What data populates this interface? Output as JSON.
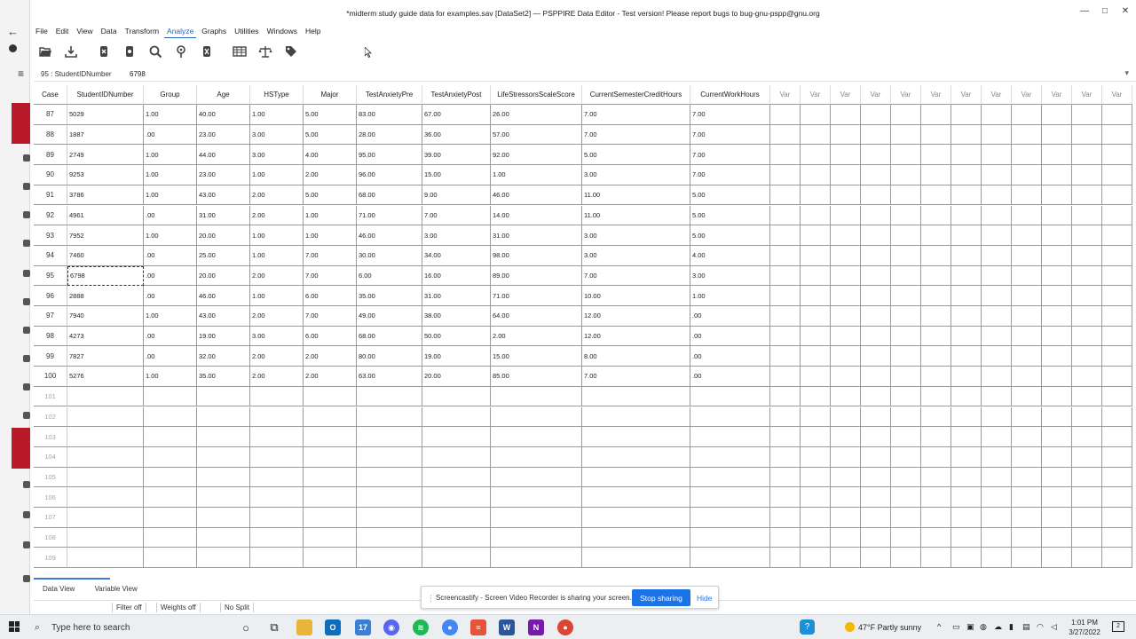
{
  "window": {
    "title": "*midterm study guide data for examples.sav [DataSet2] — PSPPIRE Data Editor - Test version! Please report bugs to bug-gnu-pspp@gnu.org",
    "minimize_glyph": "—",
    "maximize_glyph": "□",
    "close_glyph": "✕"
  },
  "menu": [
    "File",
    "Edit",
    "View",
    "Data",
    "Transform",
    "Analyze",
    "Graphs",
    "Utilities",
    "Windows",
    "Help"
  ],
  "menu_active": "Analyze",
  "toolbar_icons": [
    "open-icon",
    "save-icon",
    "goto-case-icon",
    "goto-variable-icon",
    "find-icon",
    "insert-case-icon",
    "insert-variable-icon",
    "split-file-icon",
    "weight-cases-icon",
    "value-labels-icon"
  ],
  "cell_ref": {
    "reference": "95 : StudentIDNumber",
    "value": "6798"
  },
  "columns": [
    "Case",
    "StudentIDNumber",
    "Group",
    "Age",
    "HSType",
    "Major",
    "TestAnxietyPre",
    "TestAnxietyPost",
    "LifeStressorsScaleScore",
    "CurrentSemesterCreditHours",
    "CurrentWorkHours",
    "Var",
    "Var",
    "Var",
    "Var",
    "Var",
    "Var",
    "Var",
    "Var",
    "Var",
    "Var",
    "Var",
    "Var"
  ],
  "rows": [
    [
      "87",
      "5029",
      "1.00",
      "40.00",
      "1.00",
      "5.00",
      "83.00",
      "67.00",
      "26.00",
      "7.00",
      "7.00"
    ],
    [
      "88",
      "1887",
      ".00",
      "23.00",
      "3.00",
      "5.00",
      "28.00",
      "36.00",
      "57.00",
      "7.00",
      "7.00"
    ],
    [
      "89",
      "2749",
      "1.00",
      "44.00",
      "3.00",
      "4.00",
      "95.00",
      "39.00",
      "92.00",
      "5.00",
      "7.00"
    ],
    [
      "90",
      "9253",
      "1.00",
      "23.00",
      "1.00",
      "2.00",
      "96.00",
      "15.00",
      "1.00",
      "3.00",
      "7.00"
    ],
    [
      "91",
      "3786",
      "1.00",
      "43.00",
      "2.00",
      "5.00",
      "68.00",
      "9.00",
      "46.00",
      "11.00",
      "5.00"
    ],
    [
      "92",
      "4961",
      ".00",
      "31.00",
      "2.00",
      "1.00",
      "71.00",
      "7.00",
      "14.00",
      "11.00",
      "5.00"
    ],
    [
      "93",
      "7952",
      "1.00",
      "20.00",
      "1.00",
      "1.00",
      "46.00",
      "3.00",
      "31.00",
      "3.00",
      "5.00"
    ],
    [
      "94",
      "7460",
      ".00",
      "25.00",
      "1.00",
      "7.00",
      "30.00",
      "34.00",
      "98.00",
      "3.00",
      "4.00"
    ],
    [
      "95",
      "6798",
      ".00",
      "20.00",
      "2.00",
      "7.00",
      "6.00",
      "16.00",
      "89.00",
      "7.00",
      "3.00"
    ],
    [
      "96",
      "2888",
      ".00",
      "46.00",
      "1.00",
      "6.00",
      "35.00",
      "31.00",
      "71.00",
      "10.00",
      "1.00"
    ],
    [
      "97",
      "7940",
      "1.00",
      "43.00",
      "2.00",
      "7.00",
      "49.00",
      "38.00",
      "64.00",
      "12.00",
      ".00"
    ],
    [
      "98",
      "4273",
      ".00",
      "19.00",
      "3.00",
      "6.00",
      "68.00",
      "50.00",
      "2.00",
      "12.00",
      ".00"
    ],
    [
      "99",
      "7827",
      ".00",
      "32.00",
      "2.00",
      "2.00",
      "80.00",
      "19.00",
      "15.00",
      "8.00",
      ".00"
    ],
    [
      "100",
      "5276",
      "1.00",
      "35.00",
      "2.00",
      "2.00",
      "63.00",
      "20.00",
      "85.00",
      "7.00",
      ".00"
    ]
  ],
  "empty_rows": [
    "101",
    "102",
    "103",
    "104",
    "105",
    "106",
    "107",
    "108",
    "109"
  ],
  "active_cell": {
    "row": "95",
    "column": "StudentIDNumber"
  },
  "tabs": [
    "Data View",
    "Variable View"
  ],
  "status": {
    "filter": "Filter off",
    "weights": "Weights off",
    "split": "No Split"
  },
  "screencastify": {
    "message": "Screencastify - Screen Video Recorder is sharing your screen.",
    "stop_label": "Stop sharing",
    "hide_label": "Hide"
  },
  "taskbar": {
    "search_placeholder": "Type here to search",
    "weather": "47°F  Partly sunny",
    "time": "1:01 PM",
    "date": "3/27/2022",
    "notif_count": "2"
  },
  "colors": {
    "accent": "#1a73e8",
    "menu_active": "#2a62b8",
    "behind_red": "#b81a2a"
  }
}
